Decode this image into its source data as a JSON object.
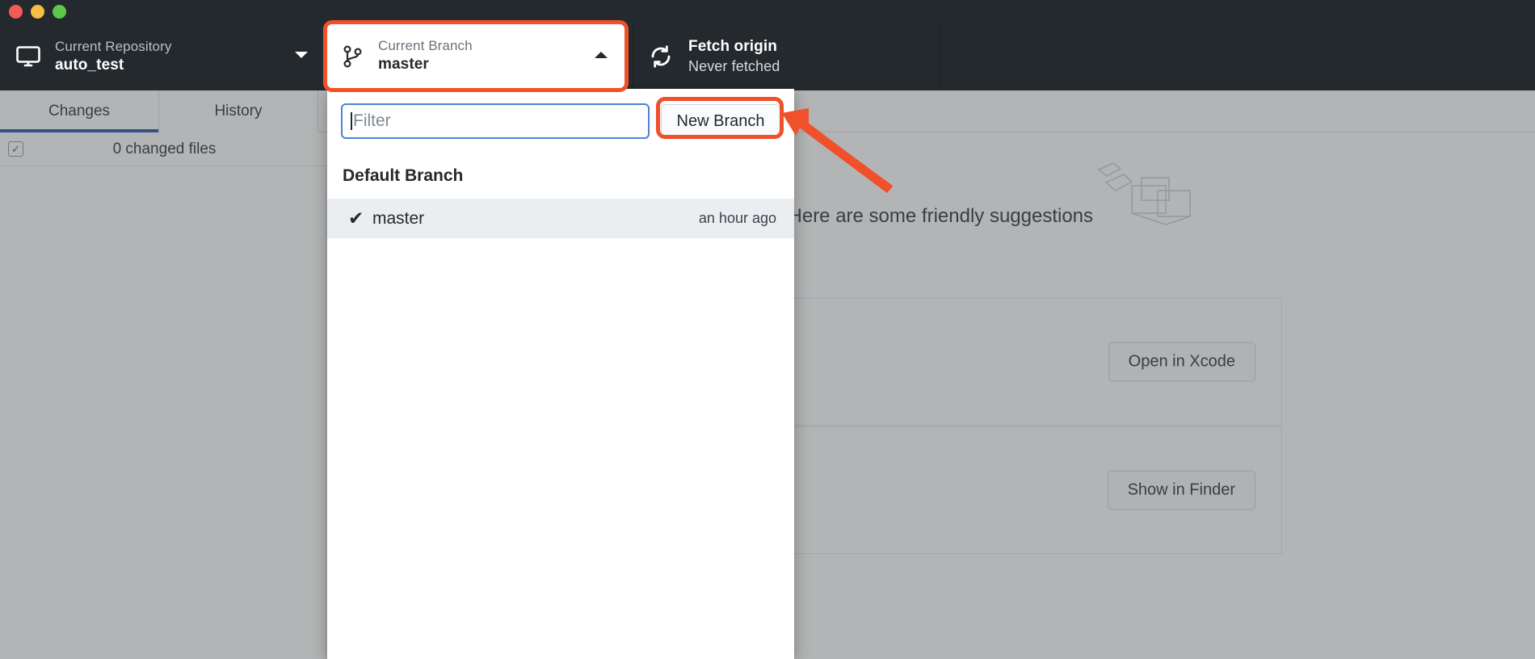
{
  "window": {
    "traffic_lights": [
      "close",
      "minimize",
      "zoom"
    ],
    "colors": {
      "titlebar": "#24292e",
      "accent_highlight": "#f0502a",
      "focus_blue": "#4c82d6",
      "tab_underline": "#1351a3"
    }
  },
  "toolbar": {
    "repository": {
      "icon": "repository-monitor-icon",
      "label": "Current Repository",
      "value": "auto_test",
      "caret": "chevron-down-icon"
    },
    "branch": {
      "icon": "branch-icon",
      "label": "Current Branch",
      "value": "master",
      "caret": "chevron-up-icon"
    },
    "fetch": {
      "icon": "sync-icon",
      "label": "Fetch origin",
      "value": "Never fetched"
    }
  },
  "tabs": [
    {
      "label": "Changes",
      "active": true
    },
    {
      "label": "History",
      "active": false
    }
  ],
  "changes": {
    "checkbox_glyph": "✓",
    "summary": "0 changed files"
  },
  "content": {
    "no_changes_text": "y. Here are some friendly suggestions",
    "cards": [
      {
        "button_label": "Open in Xcode"
      },
      {
        "button_label": "Show in Finder"
      }
    ]
  },
  "branch_popover": {
    "filter": {
      "value": "",
      "placeholder": "Filter"
    },
    "new_branch_label": "New Branch",
    "group_title": "Default Branch",
    "branches": [
      {
        "name": "master",
        "checked": true,
        "check_glyph": "✔",
        "time": "an hour ago"
      }
    ]
  },
  "annotations": {
    "highlight_color": "#f0502a",
    "arrow": "arrow-pointing-to-new-branch",
    "highlighted_targets": [
      "current-branch-button",
      "new-branch-button"
    ]
  }
}
